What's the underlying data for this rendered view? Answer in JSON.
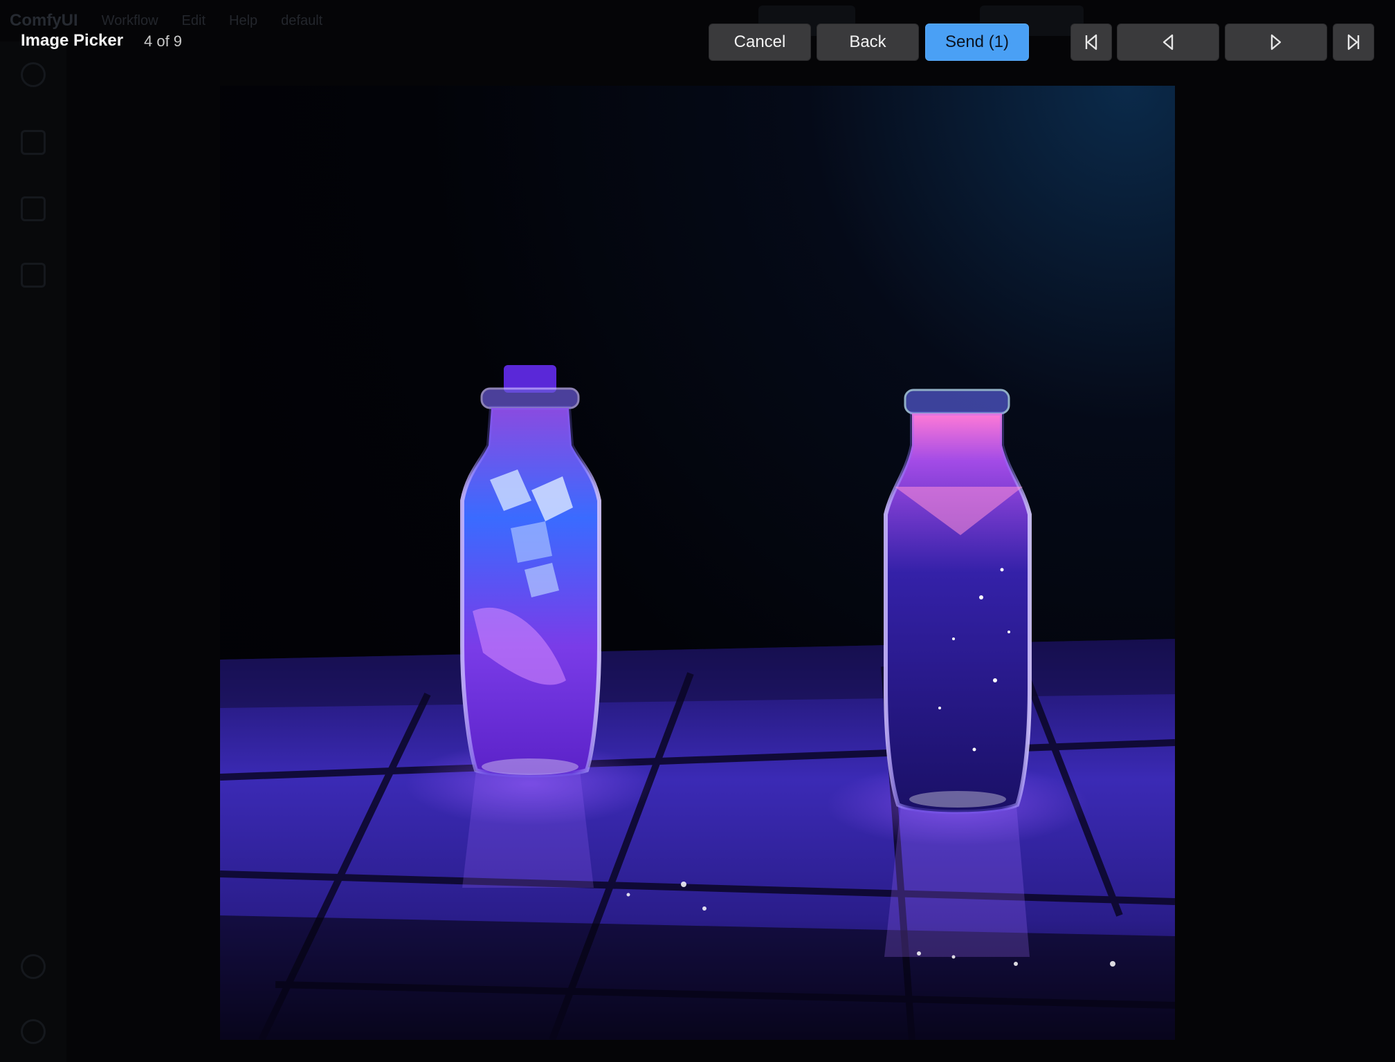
{
  "underlay": {
    "brand": "ComfyUI",
    "menu": [
      "Workflow",
      "Edit",
      "Help"
    ],
    "workflow_tab": "default"
  },
  "picker": {
    "title": "Image Picker",
    "position": "4 of 9",
    "current_index": 4,
    "total": 9
  },
  "actions": {
    "cancel_label": "Cancel",
    "back_label": "Back",
    "send_label": "Send (1)"
  },
  "nav": {
    "first_icon": "skip-first-icon",
    "prev_icon": "triangle-left-icon",
    "next_icon": "triangle-right-icon",
    "last_icon": "skip-last-icon"
  },
  "colors": {
    "send_button": "#4aa0f5",
    "neutral_button": "#3a3a3c",
    "backdrop": "#050507"
  },
  "image": {
    "subject": "two-glowing-bottles"
  }
}
